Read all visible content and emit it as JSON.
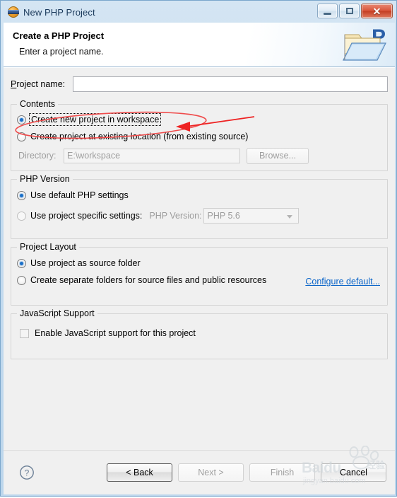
{
  "window": {
    "title": "New PHP Project",
    "icon": "eclipse-php-icon",
    "minimize_label": "–",
    "maximize_label": "□",
    "close_label": "✕"
  },
  "header": {
    "title": "Create a PHP Project",
    "subtitle": "Enter a project name.",
    "icon": "php-folder-banner-icon"
  },
  "form": {
    "project_name_label": "Project name:",
    "project_name_mnemonic": "P",
    "project_name_value": "",
    "project_name_placeholder": ""
  },
  "contents": {
    "group_label": "Contents",
    "options": [
      {
        "label": "Create new project in workspace",
        "selected": true,
        "focused": true
      },
      {
        "label": "Create project at existing location (from existing source)",
        "selected": false,
        "focused": false
      }
    ],
    "directory_label": "Directory:",
    "directory_value": "E:\\workspace",
    "browse_label": "Browse...",
    "directory_enabled": false
  },
  "php_version": {
    "group_label": "PHP Version",
    "options": [
      {
        "label": "Use default PHP settings",
        "selected": true
      },
      {
        "label": "Use project specific settings:",
        "selected": false
      }
    ],
    "version_label": "PHP Version:",
    "version_value": "PHP 5.6",
    "version_enabled": false
  },
  "project_layout": {
    "group_label": "Project Layout",
    "options": [
      {
        "label": "Use project as source folder",
        "selected": true
      },
      {
        "label": "Create separate folders for source files and public resources",
        "selected": false
      }
    ],
    "configure_link": "Configure default..."
  },
  "javascript_support": {
    "group_label": "JavaScript Support",
    "checkbox_label": "Enable JavaScript support for this project",
    "checked": false
  },
  "footer": {
    "help_icon": "help-question-icon",
    "buttons": [
      {
        "label": "< Back",
        "enabled": true,
        "default": true
      },
      {
        "label": "Next >",
        "enabled": false,
        "default": false
      },
      {
        "label": "Finish",
        "enabled": false,
        "default": false
      },
      {
        "label": "Cancel",
        "enabled": true,
        "default": false
      }
    ]
  },
  "annotation": {
    "shape": "red-ellipse-and-arrow",
    "color": "#ee2222",
    "target": "Create new project in workspace"
  },
  "watermark": {
    "brand": "Baidu",
    "brand_cn": "经验",
    "url": "jingyan.baidu.com"
  },
  "colors": {
    "accent": "#1b70c8",
    "link": "#0a64c8",
    "dialog_bg": "#f0f0f0",
    "frame": "#bcd6ec",
    "annotation_red": "#ee2222"
  }
}
